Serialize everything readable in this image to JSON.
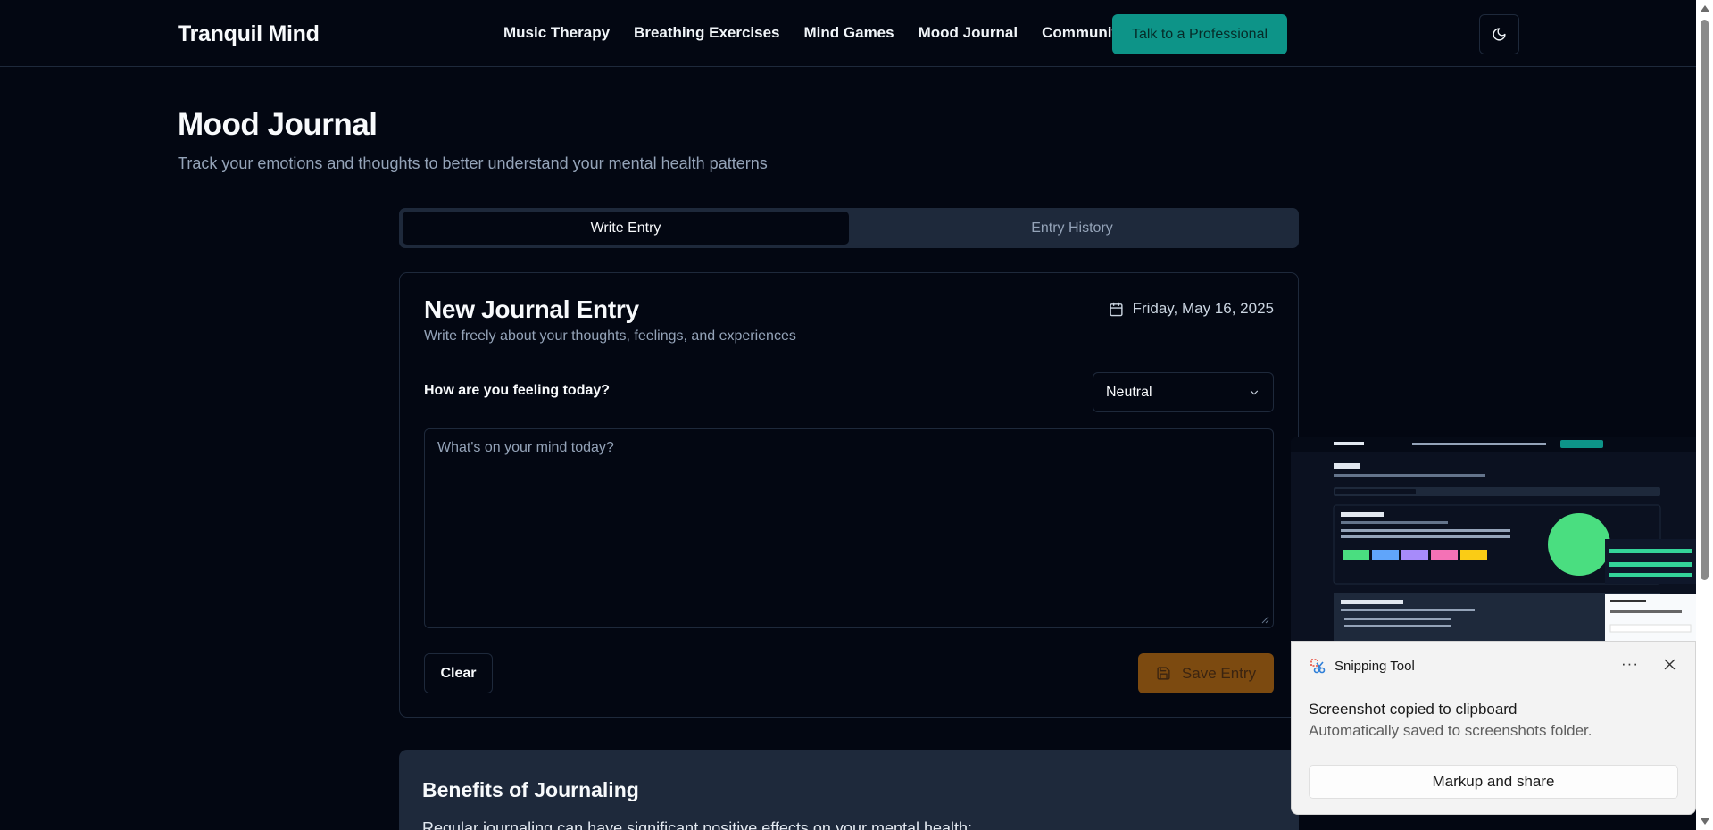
{
  "header": {
    "brand": "Tranquil Mind",
    "nav": [
      "Music Therapy",
      "Breathing Exercises",
      "Mind Games",
      "Mood Journal",
      "Community"
    ],
    "cta_label": "Talk to a Professional",
    "theme_icon": "moon-icon"
  },
  "page": {
    "title": "Mood Journal",
    "subtitle": "Track your emotions and thoughts to better understand your mental health patterns"
  },
  "tabs": [
    {
      "label": "Write Entry",
      "active": true
    },
    {
      "label": "Entry History",
      "active": false
    }
  ],
  "entry": {
    "title": "New Journal Entry",
    "description": "Write freely about your thoughts, feelings, and experiences",
    "date": "Friday, May 16, 2025",
    "mood_label": "How are you feeling today?",
    "mood_value": "Neutral",
    "text_value": "",
    "text_placeholder": "What's on your mind today?",
    "clear_label": "Clear",
    "save_label": "Save Entry"
  },
  "benefits": {
    "title": "Benefits of Journaling",
    "intro": "Regular journaling can have significant positive effects on your mental health:"
  },
  "toast": {
    "app_name": "Snipping Tool",
    "heading": "Screenshot copied to clipboard",
    "body": "Automatically saved to screenshots folder.",
    "action_label": "Markup and share",
    "more_label": "···"
  },
  "colors": {
    "background": "#030712",
    "accent": "#0d9488",
    "save": "#7c4a10",
    "border": "#1e293b",
    "muted": "#94a3b8"
  }
}
